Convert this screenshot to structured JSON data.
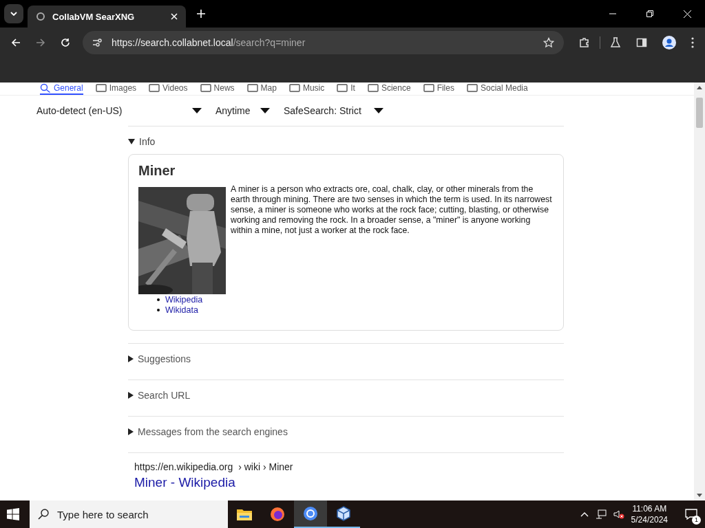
{
  "browser": {
    "tab_title": "CollabVM SearXNG",
    "url_host": "https://search.collabnet.local",
    "url_path": "/search?q=miner"
  },
  "categories": [
    {
      "label": "General",
      "selected": true
    },
    {
      "label": "Images",
      "selected": false
    },
    {
      "label": "Videos",
      "selected": false
    },
    {
      "label": "News",
      "selected": false
    },
    {
      "label": "Map",
      "selected": false
    },
    {
      "label": "Music",
      "selected": false
    },
    {
      "label": "It",
      "selected": false
    },
    {
      "label": "Science",
      "selected": false
    },
    {
      "label": "Files",
      "selected": false
    },
    {
      "label": "Social Media",
      "selected": false
    }
  ],
  "filters": {
    "language": "Auto-detect (en-US)",
    "time": "Anytime",
    "safesearch": "SafeSearch: Strict"
  },
  "infobox": {
    "section": "Info",
    "expanded": true,
    "title": "Miner",
    "image": {
      "kind": "picture"
    },
    "text": "A miner is a person who extracts ore, coal, chalk, clay, or other minerals from the earth through mining. There are two senses in which the term is used. In its narrowest sense, a miner is someone who works at the rock face; cutting, blasting, or otherwise working and removing the rock. In a broader sense, a \"miner\" is anyone working within a mine, not just a worker at the rock face.",
    "links": [
      "Wikipedia",
      "Wikidata"
    ]
  },
  "sections": [
    {
      "label": "Suggestions",
      "expanded": false
    },
    {
      "label": "Search URL",
      "expanded": false
    },
    {
      "label": "Messages from the search engines",
      "expanded": false
    }
  ],
  "result": {
    "host": "https://en.wikipedia.org",
    "path": "› wiki › Miner",
    "title": "Miner - Wikipedia"
  },
  "taskbar": {
    "search_placeholder": "Type here to search",
    "time": "11:06 AM",
    "date": "5/24/2024",
    "notifications": "1"
  }
}
